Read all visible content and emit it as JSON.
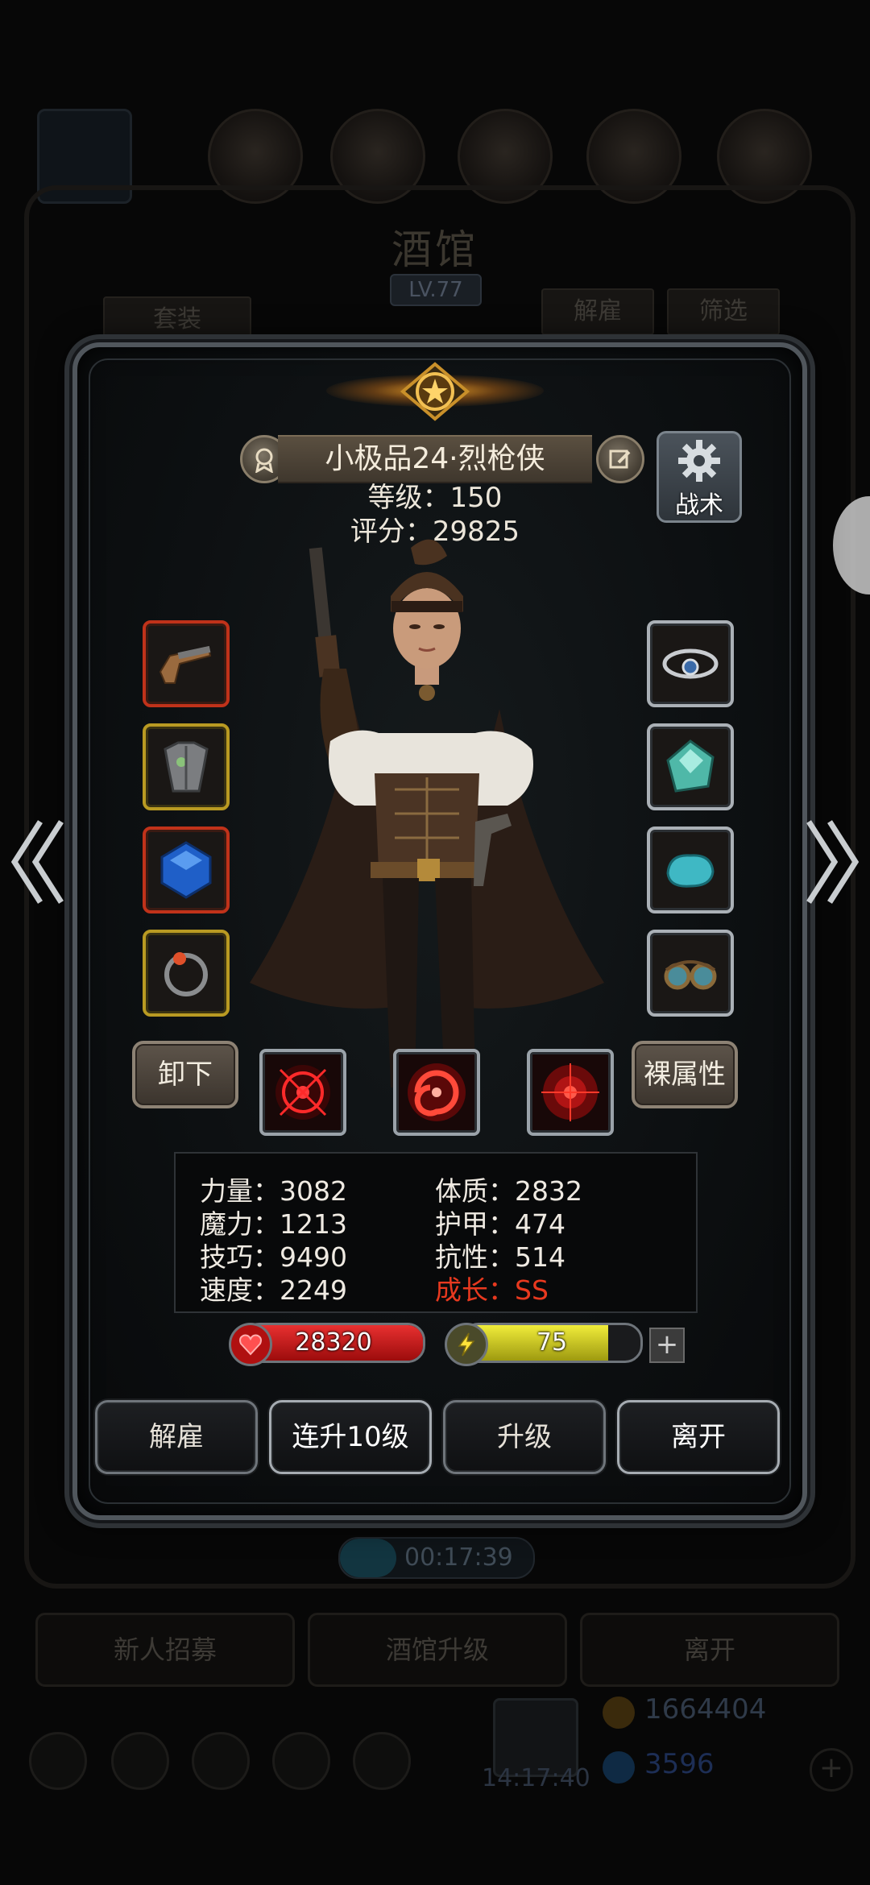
{
  "background": {
    "title": "酒馆",
    "level": "LV.77",
    "tab_suits": "套装",
    "tab_dismiss": "解雇",
    "tab_filter": "筛选",
    "timer": "00:17:39",
    "btn_recruit": "新人招募",
    "btn_upgrade_tavern": "酒馆升级",
    "btn_leave": "离开",
    "time": "14:17:40",
    "gold": "1664404",
    "gems": "3596"
  },
  "hero": {
    "name": "小极品24·烈枪侠",
    "level_text": "等级：150",
    "score_text": "评分：29825"
  },
  "tactics_label": "战术",
  "buttons": {
    "unequip": "卸下",
    "base_attr": "裸属性",
    "dismiss": "解雇",
    "level10": "连升10级",
    "levelup": "升级",
    "leave": "离开",
    "add": "+"
  },
  "stats": {
    "strength": "力量：3082",
    "constitution": "体质：2832",
    "magic": "魔力：1213",
    "armor": "护甲：474",
    "skill": "技巧：9490",
    "resistance": "抗性：514",
    "speed": "速度：2249",
    "growth": "成长：SS"
  },
  "hp": {
    "value": "28320",
    "fill_fraction": 1.0,
    "color": "#d01818"
  },
  "energy": {
    "value": "75",
    "fill_fraction": 0.82,
    "color": "#d8d51c"
  },
  "icons": {
    "left_slots": [
      "pistol-icon",
      "armor-icon",
      "sapphire-icon",
      "ring-icon"
    ],
    "right_slots": [
      "necklace-icon",
      "crystal-icon",
      "stone-icon",
      "goggles-icon"
    ],
    "skills": [
      "crosshair-skill-icon",
      "vortex-skill-icon",
      "target-skill-icon"
    ]
  },
  "colors": {
    "slot_red": "#c0321a",
    "slot_gold": "#b99a22",
    "slot_silver": "#aab0b6",
    "growth": "#e8391f"
  }
}
